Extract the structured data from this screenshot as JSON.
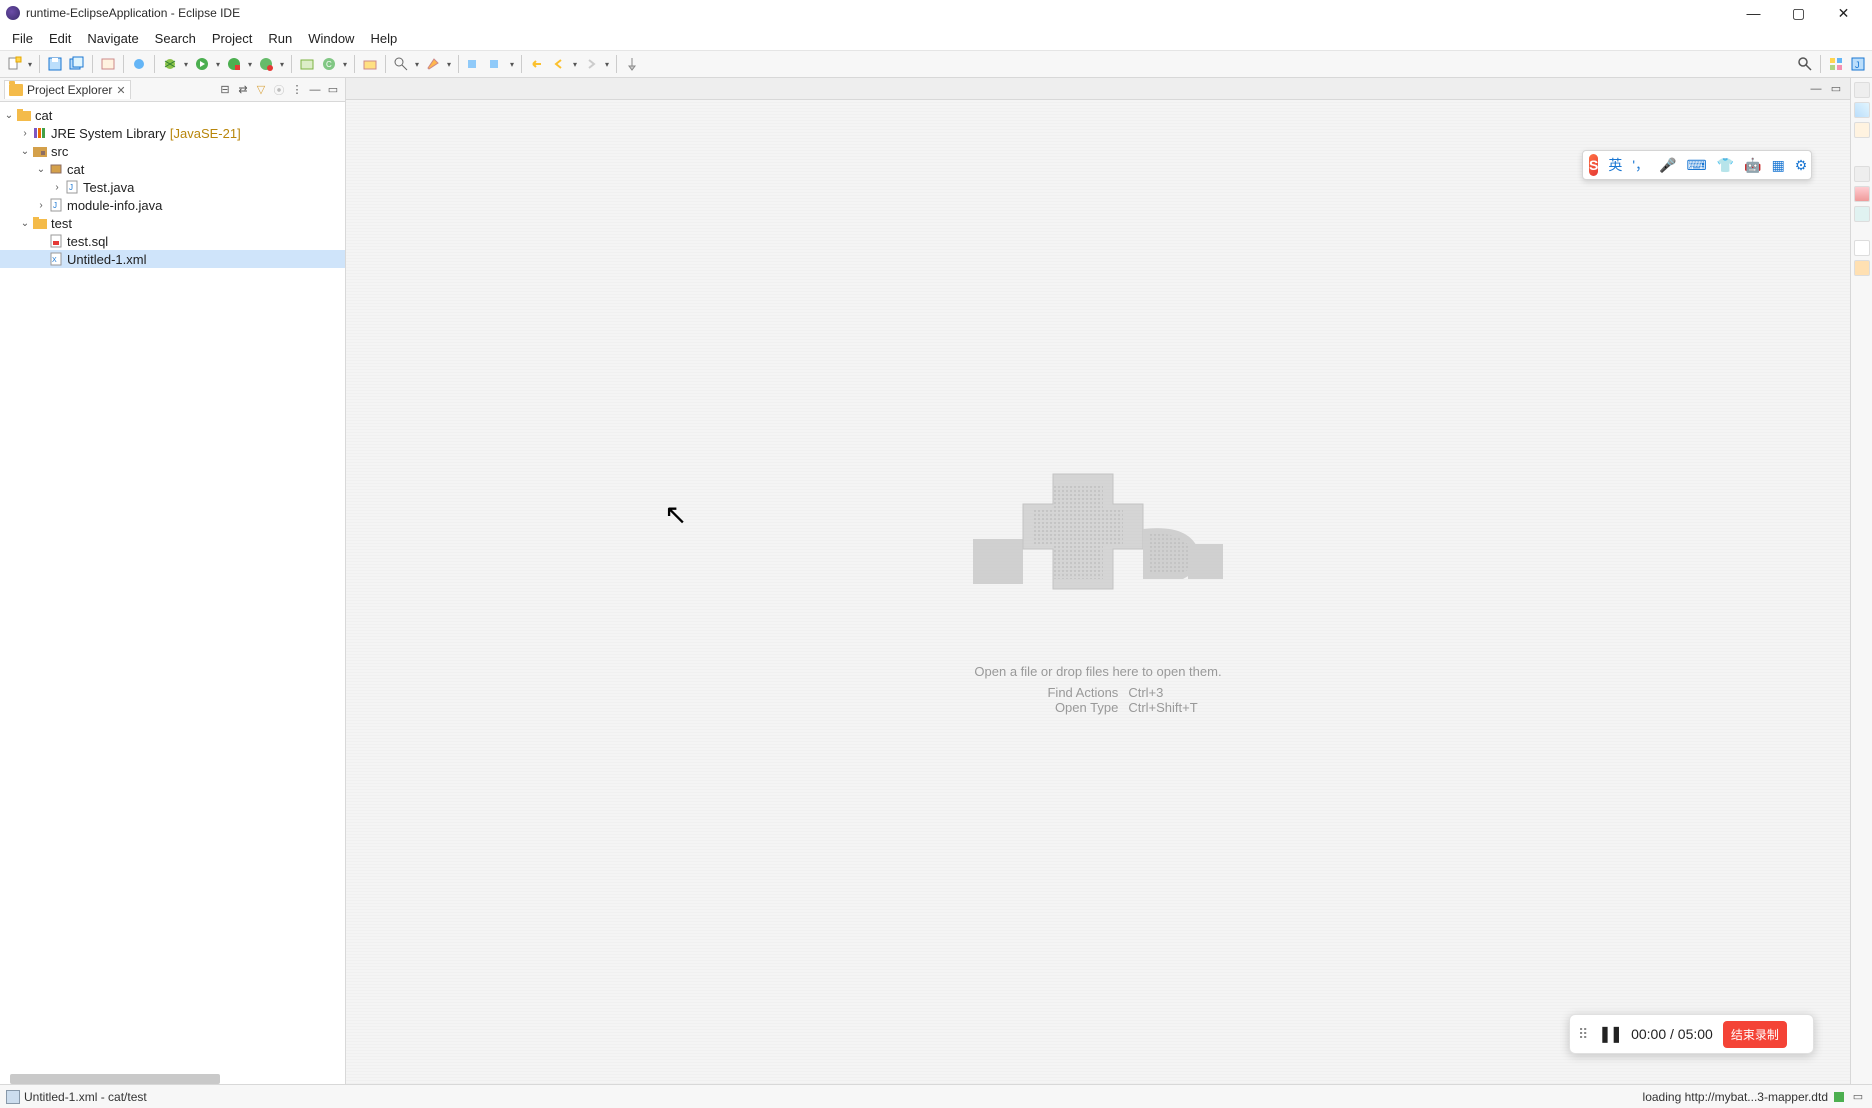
{
  "window": {
    "title": "runtime-EclipseApplication - Eclipse IDE"
  },
  "menu": [
    "File",
    "Edit",
    "Navigate",
    "Search",
    "Project",
    "Run",
    "Window",
    "Help"
  ],
  "views": {
    "project_explorer": {
      "title": "Project Explorer"
    }
  },
  "tree": {
    "cat": {
      "label": "cat",
      "jre": {
        "label": "JRE System Library",
        "annot": "[JavaSE-21]"
      },
      "src": {
        "label": "src",
        "pkg_cat": {
          "label": "cat",
          "test_java": "Test.java"
        },
        "module_info": "module-info.java"
      },
      "test": {
        "label": "test",
        "test_sql": "test.sql",
        "untitled_xml": "Untitled-1.xml"
      }
    }
  },
  "editor": {
    "hint": "Open a file or drop files here to open them.",
    "shortcuts": [
      {
        "label": "Find Actions",
        "key": "Ctrl+3"
      },
      {
        "label": "Open Type",
        "key": "Ctrl+Shift+T"
      }
    ]
  },
  "ime": {
    "logo": "S",
    "lang": "英"
  },
  "recording": {
    "elapsed": "00:00",
    "total": "05:00",
    "stop": "结束录制"
  },
  "status": {
    "left": "Untitled-1.xml - cat/test",
    "right": "loading http://mybat...3-mapper.dtd"
  }
}
